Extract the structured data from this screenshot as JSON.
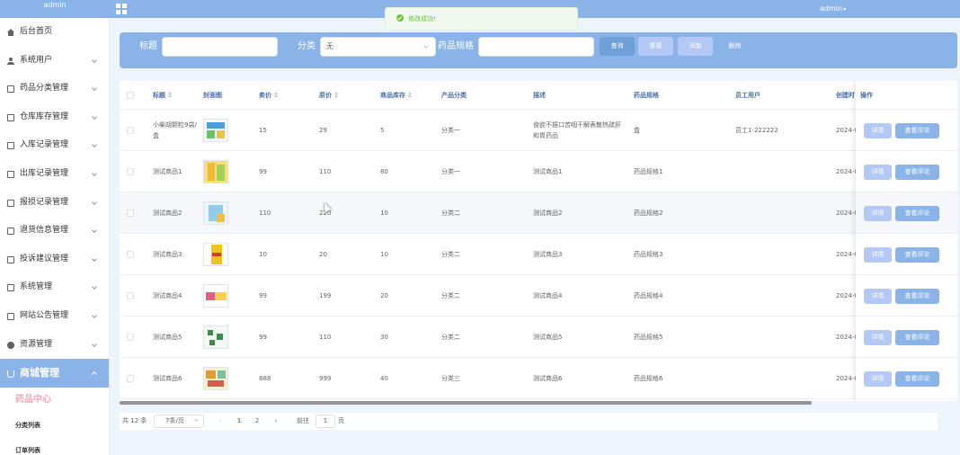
{
  "header": {
    "brand": "admin",
    "user": "admin"
  },
  "toast": {
    "message": "修改成功!"
  },
  "sidebar": {
    "items": [
      {
        "label": "后台首页",
        "icon": "home-icon"
      },
      {
        "label": "系统用户",
        "icon": "user-icon"
      },
      {
        "label": "药品分类管理",
        "icon": "doc-icon"
      },
      {
        "label": "仓库库存管理",
        "icon": "doc-icon"
      },
      {
        "label": "入库记录管理",
        "icon": "doc-icon"
      },
      {
        "label": "出库记录管理",
        "icon": "doc-icon"
      },
      {
        "label": "报损记录管理",
        "icon": "doc-icon"
      },
      {
        "label": "退货信息管理",
        "icon": "doc-icon"
      },
      {
        "label": "投诉建议管理",
        "icon": "doc-icon"
      },
      {
        "label": "系统管理",
        "icon": "picture-icon"
      },
      {
        "label": "网站公告管理",
        "icon": "doc-icon"
      },
      {
        "label": "资源管理",
        "icon": "bulb-icon"
      }
    ],
    "active": {
      "label": "商城管理",
      "icon": "cart-icon"
    },
    "sub_head": "药品中心",
    "sub_items": [
      "分类列表",
      "订单列表"
    ]
  },
  "search": {
    "title_label": "标题",
    "category_label": "分类",
    "category_value": "无",
    "spec_label": "药品规格",
    "buttons": [
      "查询",
      "重置",
      "添加",
      "删除"
    ]
  },
  "table": {
    "headers": {
      "title": "标题",
      "cover": "封面图",
      "price": "卖价",
      "original": "原价",
      "stock": "商品库存",
      "category": "产品分类",
      "desc": "描述",
      "spec": "药品规格",
      "staff": "员工用户",
      "created": "创建时",
      "ops": "操作"
    },
    "rows": [
      {
        "title": "小柴胡颗粒9袋/盒",
        "price": "15",
        "original": "29",
        "stock": "5",
        "category": "分类一",
        "desc": "食欲不振口苦咽干解表散热疏肝和胃药品",
        "spec": "盒",
        "staff": "员工1-222222",
        "created": "2024-0"
      },
      {
        "title": "测试商品1",
        "price": "99",
        "original": "110",
        "stock": "80",
        "category": "分类一",
        "desc": "测试商品1",
        "spec": "药品规格1",
        "staff": "",
        "created": "2024-0"
      },
      {
        "title": "测试商品2",
        "price": "110",
        "original": "220",
        "stock": "10",
        "category": "分类二",
        "desc": "测试商品2",
        "spec": "药品规格2",
        "staff": "",
        "created": "2024-0"
      },
      {
        "title": "测试商品3",
        "price": "10",
        "original": "20",
        "stock": "10",
        "category": "分类二",
        "desc": "测试商品3",
        "spec": "药品规格3",
        "staff": "",
        "created": "2024-0"
      },
      {
        "title": "测试商品4",
        "price": "99",
        "original": "199",
        "stock": "20",
        "category": "分类二",
        "desc": "测试商品4",
        "spec": "药品规格4",
        "staff": "",
        "created": "2024-0"
      },
      {
        "title": "测试商品5",
        "price": "99",
        "original": "110",
        "stock": "30",
        "category": "分类二",
        "desc": "测试商品5",
        "spec": "药品规格5",
        "staff": "",
        "created": "2024-0"
      },
      {
        "title": "测试商品6",
        "price": "888",
        "original": "999",
        "stock": "40",
        "category": "分类三",
        "desc": "测试商品6",
        "spec": "药品规格6",
        "staff": "",
        "created": "2024-0"
      }
    ],
    "detail_label": "详情",
    "review_label": "查看评论"
  },
  "pager": {
    "total": "共 12 条",
    "size": "7条/页",
    "pages": [
      "1",
      "2"
    ],
    "goto_label": "前往",
    "goto_value": "1",
    "page_unit": "页"
  },
  "colors": {
    "primary": "#8ab4e8",
    "sidebar_bg": "#ffffff",
    "sub_head": "#f3a6b6",
    "detail_btn": "#b3c8f5",
    "success": "#67c23a"
  }
}
